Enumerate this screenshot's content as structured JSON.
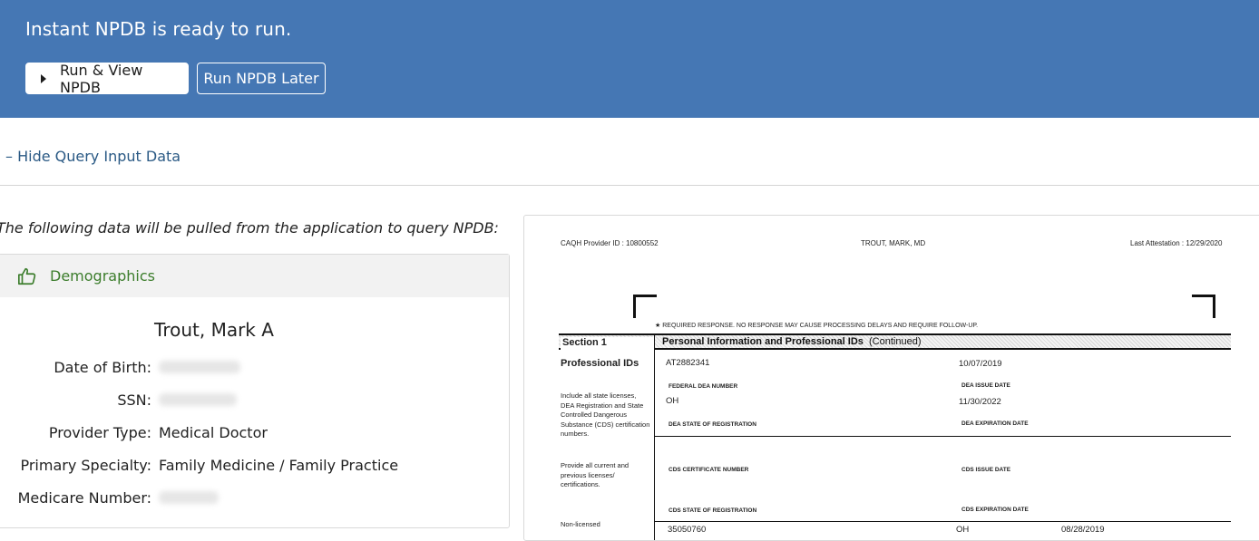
{
  "banner": {
    "title": "Instant NPDB is ready to run.",
    "run_button": "Run & View NPDB",
    "later_button": "Run NPDB Later",
    "color": "#4577b4"
  },
  "toggle": {
    "label": "– Hide Query Input Data"
  },
  "intro": "The following data will be pulled from the application to query NPDB:",
  "demographics": {
    "heading": "Demographics",
    "heading_icon": "thumbs-up-icon",
    "name": "Trout, Mark A",
    "fields": [
      {
        "label": "Date of Birth:",
        "value": ""
      },
      {
        "label": "SSN:",
        "value": ""
      },
      {
        "label": "Provider Type:",
        "value": "Medical Doctor"
      },
      {
        "label": "Primary Specialty:",
        "value": "Family Medicine / Family Practice"
      },
      {
        "label": "Medicare Number:",
        "value": ""
      }
    ]
  },
  "document": {
    "provider_id": "CAQH Provider ID : 10800552",
    "provider_name": "TROUT, MARK, MD",
    "last_attestation": "Last Attestation : 12/29/2020",
    "required_note": "★ REQUIRED RESPONSE. NO RESPONSE MAY CAUSE PROCESSING DELAYS AND REQUIRE FOLLOW-UP.",
    "section_label": "Section 1",
    "section_title": "Personal Information and Professional IDs",
    "section_suffix": "(Continued)",
    "left_title": "Professional IDs",
    "left_note_1": "Include all state licenses, DEA Registration and State Controlled Dangerous Substance (CDS) certification numbers.",
    "left_note_2": "Provide all current and previous licenses/ certifications.",
    "left_note_3": "Non-licensed",
    "dea_number": "AT2882341",
    "dea_issue": "10/07/2019",
    "label_dea_number": "FEDERAL DEA NUMBER",
    "label_dea_issue": "DEA ISSUE DATE",
    "dea_state": "OH",
    "dea_expiration": "11/30/2022",
    "label_dea_state": "DEA STATE OF REGISTRATION",
    "label_dea_expiration": "DEA EXPIRATION DATE",
    "label_cds_number": "CDS CERTIFICATE NUMBER",
    "label_cds_issue": "CDS ISSUE DATE",
    "label_cds_state": "CDS STATE OF REGISTRATION",
    "label_cds_expiration": "CDS EXPIRATION DATE",
    "bottom_number": "35050760",
    "bottom_state": "OH",
    "bottom_date": "08/28/2019"
  }
}
